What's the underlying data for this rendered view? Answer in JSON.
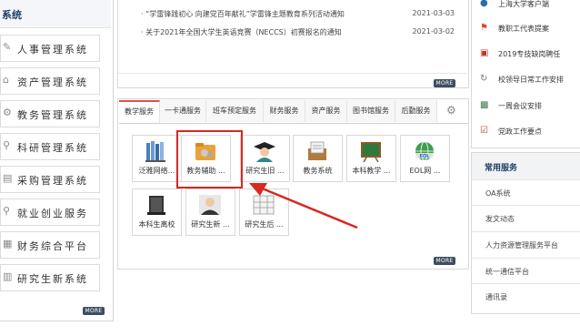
{
  "left_panel": {
    "header": "系统",
    "items": [
      {
        "label": "人事管理系统",
        "icon": "edit-icon"
      },
      {
        "label": "资产管理系统",
        "icon": "building-icon"
      },
      {
        "label": "教务管理系统",
        "icon": "gear-icon"
      },
      {
        "label": "科研管理系统",
        "icon": "microscope-icon"
      },
      {
        "label": "采购管理系统",
        "icon": "document-icon"
      },
      {
        "label": "就业创业服务",
        "icon": "magnifier-icon"
      },
      {
        "label": "财务综合平台",
        "icon": "grid-icon"
      },
      {
        "label": "研究生新系统",
        "icon": "book-icon"
      }
    ],
    "more": "MORE"
  },
  "news": {
    "items": [
      {
        "title": "· “学雷锋践初心 向建党百年献礼”学雷锋主题教育系列活动通知",
        "date": "2021-03-03"
      },
      {
        "title": "· 关于2021年全国大学生英语竞赛（NECCS）初赛报名的通知",
        "date": "2021-03-02"
      }
    ],
    "more": "MORE"
  },
  "services": {
    "tabs": [
      "教学服务",
      "一卡通服务",
      "班车预定服务",
      "财务服务",
      "资产服务",
      "图书馆服务",
      "后勤服务"
    ],
    "active_tab": "教学服务",
    "tiles": [
      {
        "label": "泛雅网络...",
        "icon": "books-icon"
      },
      {
        "label": "教务辅助 ...",
        "icon": "folder-icon"
      },
      {
        "label": "研究生旧 ...",
        "icon": "graduate-icon"
      },
      {
        "label": "教务系统",
        "icon": "inbox-icon"
      },
      {
        "label": "本科教学 ...",
        "icon": "blackboard-icon"
      },
      {
        "label": "EOL网 ...",
        "icon": "globe-icon"
      },
      {
        "label": "本科生离校",
        "icon": "book-stack-icon"
      },
      {
        "label": "研究生新 ...",
        "icon": "person-icon"
      },
      {
        "label": "研究生后 ...",
        "icon": "grid-icon"
      }
    ],
    "more": "MORE",
    "accent_color": "#d82822"
  },
  "right_panel": {
    "items": [
      {
        "label": "上海大学客户端",
        "icon": "pin-icon"
      },
      {
        "label": "教职工代表提案",
        "icon": "flag-icon"
      },
      {
        "label": "2019专技缺岗聘任",
        "icon": "clipboard-icon"
      },
      {
        "label": "校领导日常工作安排",
        "icon": "refresh-icon"
      },
      {
        "label": "一周会议安排",
        "icon": "calendar-icon"
      },
      {
        "label": "党政工作要点",
        "icon": "checklist-icon"
      }
    ],
    "common_header": "常用服务",
    "links": [
      "OA系统",
      "发文动态",
      "人力资源管理服务平台",
      "统一通信平台",
      "通讯录"
    ]
  }
}
